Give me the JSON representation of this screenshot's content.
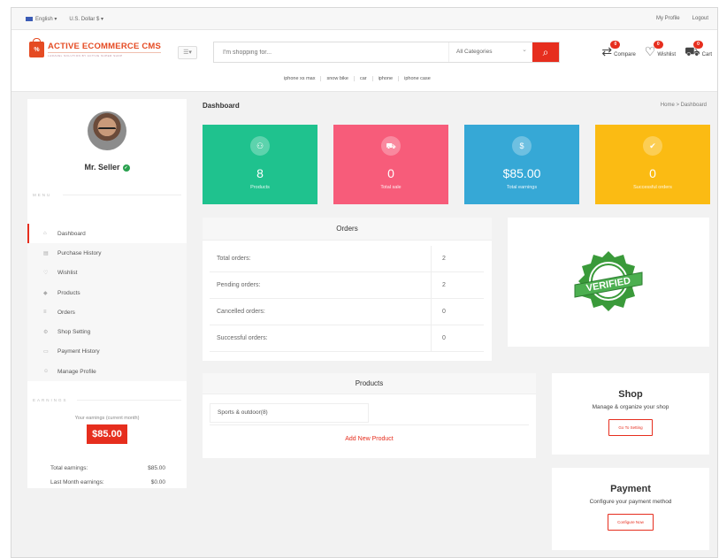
{
  "topbar": {
    "language": "English",
    "currency": "U.S. Dollar $",
    "my_profile": "My Profile",
    "logout": "Logout"
  },
  "header": {
    "logo_text": "ACTIVE ECOMMERCE CMS",
    "logo_tagline": "LARAVEL SOLUTION BY ACTIVE SUPER SHOP",
    "search_placeholder": "I'm shopping for...",
    "category_select": "All Categories",
    "suggestions": [
      "iphone xs max",
      "snow bike",
      "car",
      "iphone",
      "iphone case"
    ],
    "compare": {
      "label": "Compare",
      "count": "0"
    },
    "wishlist": {
      "label": "Wishlist",
      "count": "0"
    },
    "cart": {
      "label": "Cart",
      "count": "0"
    }
  },
  "sidebar": {
    "seller_name": "Mr. Seller",
    "menu_label": "MENU",
    "items": [
      {
        "label": "Dashboard",
        "icon": "home-icon",
        "glyph": "⌂"
      },
      {
        "label": "Purchase History",
        "icon": "file-icon",
        "glyph": "▤"
      },
      {
        "label": "Wishlist",
        "icon": "heart-icon",
        "glyph": "♡"
      },
      {
        "label": "Products",
        "icon": "diamond-icon",
        "glyph": "◆"
      },
      {
        "label": "Orders",
        "icon": "list-icon",
        "glyph": "≡"
      },
      {
        "label": "Shop Setting",
        "icon": "gear-icon",
        "glyph": "⚙"
      },
      {
        "label": "Payment History",
        "icon": "card-icon",
        "glyph": "▭"
      },
      {
        "label": "Manage Profile",
        "icon": "user-icon",
        "glyph": "☺"
      }
    ],
    "earnings_label": "EARNINGS",
    "earnings_caption": "Your earnings (current month)",
    "earnings_value": "$85.00",
    "total_earnings_label": "Total earnings:",
    "total_earnings_value": "$85.00",
    "last_month_label": "Last Month earnings:",
    "last_month_value": "$0.00"
  },
  "main": {
    "title": "Dashboard",
    "breadcrumb": "Home > Dashboard",
    "cards": [
      {
        "value": "8",
        "caption": "Products",
        "color": "#1fc28e",
        "icon": "user-icon",
        "glyph": "⚇"
      },
      {
        "value": "0",
        "caption": "Total sale",
        "color": "#f75c7a",
        "icon": "cart-icon",
        "glyph": "⛟"
      },
      {
        "value": "$85.00",
        "caption": "Total earnings",
        "color": "#36a8d6",
        "icon": "dollar-icon",
        "glyph": "$"
      },
      {
        "value": "0",
        "caption": "Successful orders",
        "color": "#fbbb13",
        "icon": "check-icon",
        "glyph": "✔"
      }
    ],
    "orders": {
      "title": "Orders",
      "rows": [
        {
          "label": "Total orders:",
          "value": "2"
        },
        {
          "label": "Pending orders:",
          "value": "2"
        },
        {
          "label": "Cancelled orders:",
          "value": "0"
        },
        {
          "label": "Successful orders:",
          "value": "0"
        }
      ]
    },
    "verified_badge": "VERIFIED",
    "products": {
      "title": "Products",
      "category": "Sports & outdoor(8)",
      "add_link": "Add New Product"
    },
    "shop": {
      "title": "Shop",
      "desc": "Manage & organize your shop",
      "button": "Go To Setting"
    },
    "payment": {
      "title": "Payment",
      "desc": "Configure your payment method",
      "button": "Configure Now"
    }
  }
}
